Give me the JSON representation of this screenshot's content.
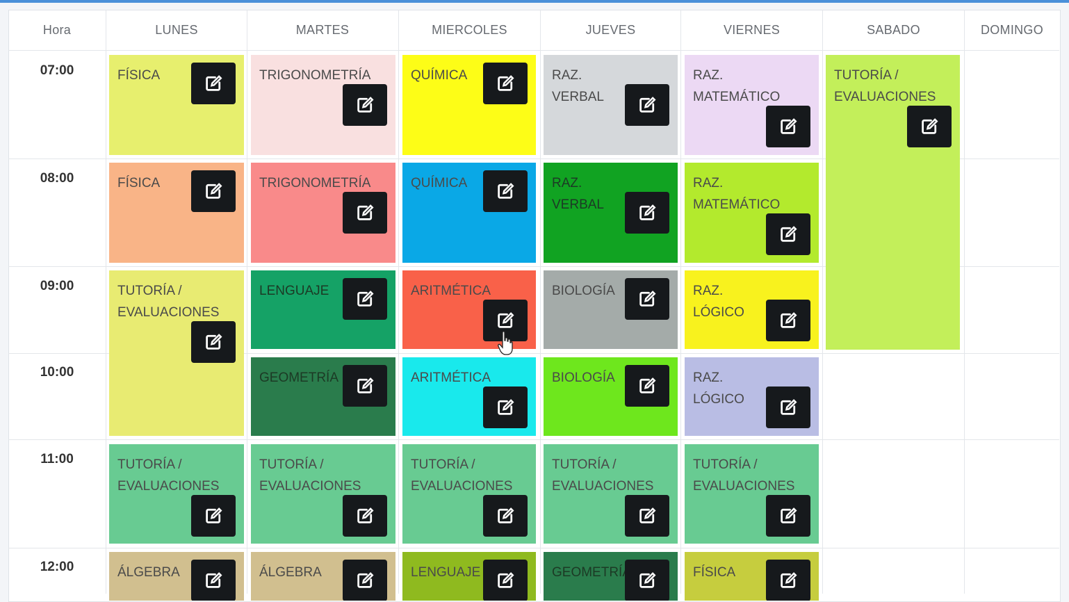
{
  "days": [
    "Hora",
    "LUNES",
    "MARTES",
    "MIERCOLES",
    "JUEVES",
    "VIERNES",
    "SABADO",
    "DOMINGO"
  ],
  "hours": [
    "07:00",
    "08:00",
    "09:00",
    "10:00",
    "11:00",
    "12:00"
  ],
  "colors": {
    "topbar": "#4a90d9",
    "edit_button": "#16191c"
  },
  "classes": [
    {
      "day": "LUNES",
      "hour": "07:00",
      "subject": "FÍSICA",
      "color": "#e7ef6e",
      "icon": "edit-icon"
    },
    {
      "day": "LUNES",
      "hour": "08:00",
      "subject": "FÍSICA",
      "color": "#f9b487",
      "icon": "edit-icon"
    },
    {
      "day": "LUNES",
      "hour": "09:00",
      "subject": "TUTORÍA / EVALUACIONES",
      "color": "#e8eb72",
      "icon": "edit-icon"
    },
    {
      "day": "LUNES",
      "hour": "11:00",
      "subject": "TUTORÍA / EVALUACIONES",
      "color": "#68cb92",
      "icon": "edit-icon"
    },
    {
      "day": "LUNES",
      "hour": "12:00",
      "subject": "ÁLGEBRA",
      "color": "#d1bf8f",
      "icon": "edit-icon"
    },
    {
      "day": "MARTES",
      "hour": "07:00",
      "subject": "TRIGONOMETRÍA",
      "color": "#f9e0e0",
      "icon": "edit-icon"
    },
    {
      "day": "MARTES",
      "hour": "08:00",
      "subject": "TRIGONOMETRÍA",
      "color": "#f98a8a",
      "icon": "edit-icon"
    },
    {
      "day": "MARTES",
      "hour": "09:00",
      "subject": "LENGUAJE",
      "color": "#15a266",
      "icon": "edit-icon"
    },
    {
      "day": "MARTES",
      "hour": "10:00",
      "subject": "GEOMETRÍA",
      "color": "#2a7c4c",
      "icon": "edit-icon"
    },
    {
      "day": "MARTES",
      "hour": "11:00",
      "subject": "TUTORÍA / EVALUACIONES",
      "color": "#68cb92",
      "icon": "edit-icon"
    },
    {
      "day": "MARTES",
      "hour": "12:00",
      "subject": "ÁLGEBRA",
      "color": "#d1bf8f",
      "icon": "edit-icon"
    },
    {
      "day": "MIERCOLES",
      "hour": "07:00",
      "subject": "QUÍMICA",
      "color": "#fdfd17",
      "icon": "edit-icon"
    },
    {
      "day": "MIERCOLES",
      "hour": "08:00",
      "subject": "QUÍMICA",
      "color": "#0aa8e6",
      "icon": "edit-icon"
    },
    {
      "day": "MIERCOLES",
      "hour": "09:00",
      "subject": "ARITMÉTICA",
      "color": "#f96149",
      "icon": "edit-icon"
    },
    {
      "day": "MIERCOLES",
      "hour": "10:00",
      "subject": "ARITMÉTICA",
      "color": "#19e9ec",
      "icon": "edit-icon"
    },
    {
      "day": "MIERCOLES",
      "hour": "11:00",
      "subject": "TUTORÍA / EVALUACIONES",
      "color": "#68cb92",
      "icon": "edit-icon"
    },
    {
      "day": "MIERCOLES",
      "hour": "12:00",
      "subject": "LENGUAJE",
      "color": "#8fba1f",
      "icon": "edit-icon"
    },
    {
      "day": "JUEVES",
      "hour": "07:00",
      "subject": "RAZ. VERBAL",
      "color": "#d5d8db",
      "icon": "edit-icon"
    },
    {
      "day": "JUEVES",
      "hour": "08:00",
      "subject": "RAZ. VERBAL",
      "color": "#11a322",
      "icon": "edit-icon"
    },
    {
      "day": "JUEVES",
      "hour": "09:00",
      "subject": "BIOLOGÍA",
      "color": "#a4aba9",
      "icon": "edit-icon"
    },
    {
      "day": "JUEVES",
      "hour": "10:00",
      "subject": "BIOLOGÍA",
      "color": "#6ee71d",
      "icon": "edit-icon"
    },
    {
      "day": "JUEVES",
      "hour": "11:00",
      "subject": "TUTORÍA / EVALUACIONES",
      "color": "#68cb92",
      "icon": "edit-icon"
    },
    {
      "day": "JUEVES",
      "hour": "12:00",
      "subject": "GEOMETRÍA",
      "color": "#2a7c4c",
      "icon": "edit-icon"
    },
    {
      "day": "VIERNES",
      "hour": "07:00",
      "subject": "RAZ. MATEMÁTICO",
      "color": "#ecd9f4",
      "icon": "edit-icon"
    },
    {
      "day": "VIERNES",
      "hour": "08:00",
      "subject": "RAZ. MATEMÁTICO",
      "color": "#b3ea2d",
      "icon": "edit-icon"
    },
    {
      "day": "VIERNES",
      "hour": "09:00",
      "subject": "RAZ. LÓGICO",
      "color": "#f8f21e",
      "icon": "edit-icon"
    },
    {
      "day": "VIERNES",
      "hour": "10:00",
      "subject": "RAZ. LÓGICO",
      "color": "#b9bde4",
      "icon": "edit-icon"
    },
    {
      "day": "VIERNES",
      "hour": "11:00",
      "subject": "TUTORÍA / EVALUACIONES",
      "color": "#68cb92",
      "icon": "edit-icon"
    },
    {
      "day": "VIERNES",
      "hour": "12:00",
      "subject": "FÍSICA",
      "color": "#c6cd3e",
      "icon": "edit-icon"
    },
    {
      "day": "SABADO",
      "hour": "07:00",
      "subject": "TUTORÍA / EVALUACIONES",
      "color": "#c3ef5a",
      "icon": "edit-icon"
    }
  ]
}
